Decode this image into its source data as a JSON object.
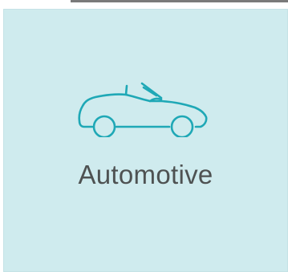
{
  "tile": {
    "label": "Automotive",
    "icon": "convertible-car-icon",
    "background_color": "#cfebee",
    "icon_color": "#1fa8b6",
    "label_color": "#4e5252"
  }
}
